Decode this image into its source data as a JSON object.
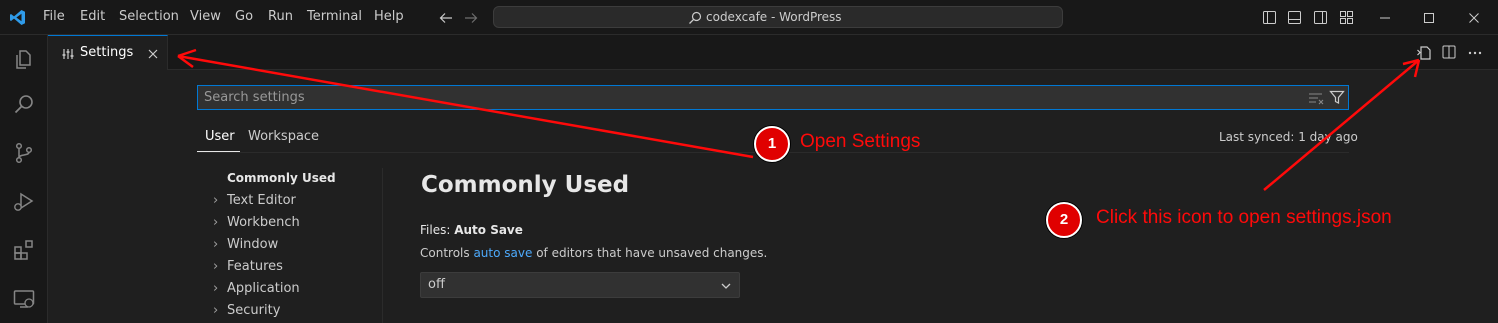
{
  "menu": [
    "File",
    "Edit",
    "Selection",
    "View",
    "Go",
    "Run",
    "Terminal",
    "Help"
  ],
  "command_center": {
    "text": "codexcafe - WordPress"
  },
  "tab": {
    "label": "Settings"
  },
  "search": {
    "placeholder": "Search settings"
  },
  "scope_tabs": {
    "user": "User",
    "workspace": "Workspace"
  },
  "last_synced": "Last synced: 1 day ago",
  "toc": {
    "commonly_used": "Commonly Used",
    "items": [
      "Text Editor",
      "Workbench",
      "Window",
      "Features",
      "Application",
      "Security"
    ]
  },
  "section": {
    "title": "Commonly Used"
  },
  "setting": {
    "category": "Files: ",
    "name": "Auto Save",
    "desc_before": "Controls ",
    "desc_link": "auto save",
    "desc_after": " of editors that have unsaved changes.",
    "value": "off"
  },
  "annotations": {
    "one": {
      "number": "1",
      "text": "Open Settings"
    },
    "two": {
      "number": "2",
      "text": "Click this icon to open settings.json"
    }
  },
  "colors": {
    "accent": "#0078d4",
    "annotation": "#ff0a0a",
    "link": "#4daafc"
  },
  "icons": [
    "vscode-logo-icon",
    "arrow-left-icon",
    "arrow-right-icon",
    "search-icon",
    "toggle-primary-sidebar-icon",
    "toggle-panel-icon",
    "toggle-secondary-sidebar-icon",
    "customize-layout-icon",
    "minimize-icon",
    "maximize-icon",
    "close-icon",
    "explorer-icon",
    "search-icon",
    "source-control-icon",
    "run-debug-icon",
    "extensions-icon",
    "remote-explorer-icon",
    "settings-editor-icon",
    "open-settings-json-icon",
    "split-editor-icon",
    "more-actions-icon",
    "clear-filter-icon",
    "filter-icon",
    "chevron-right-icon",
    "chevron-down-icon"
  ]
}
